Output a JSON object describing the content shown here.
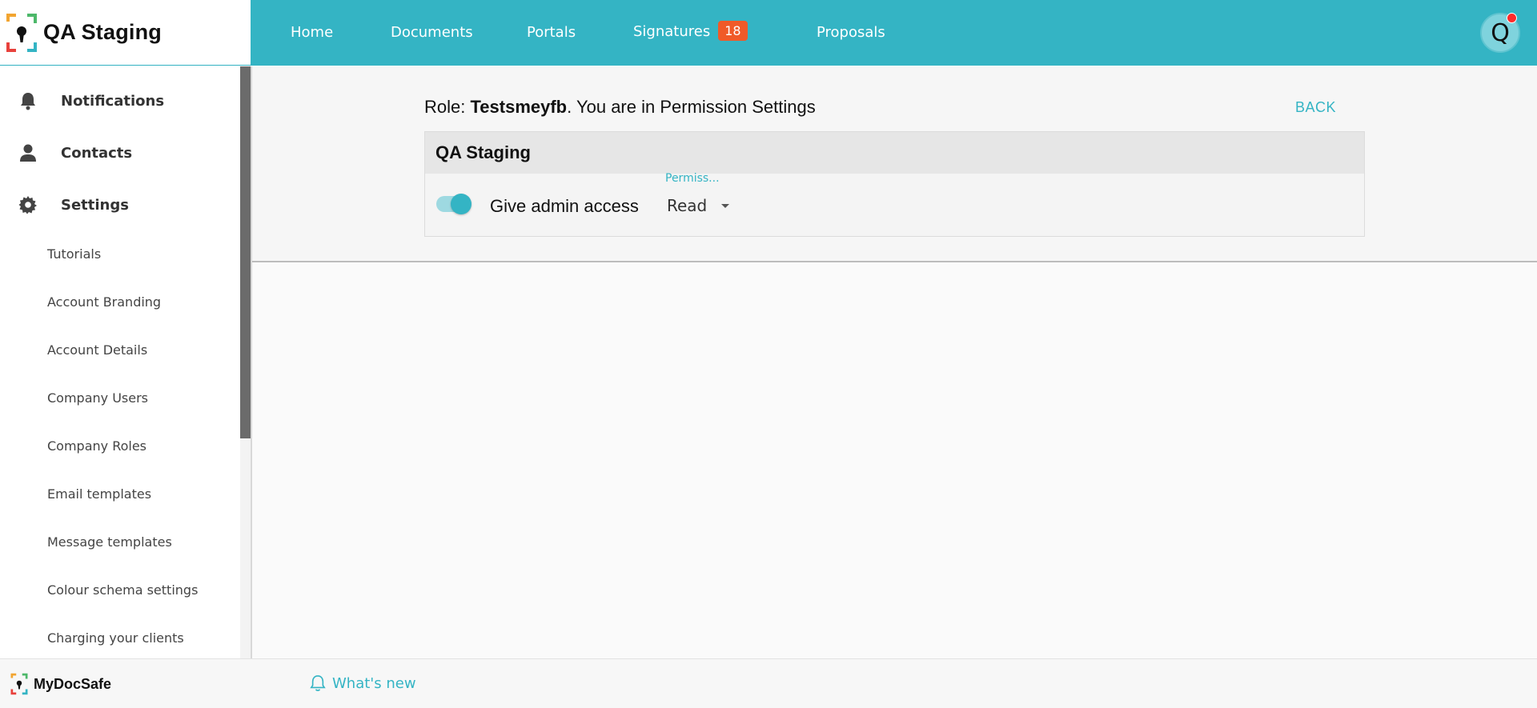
{
  "app": {
    "title": "QA Staging",
    "accent_color": "#34b4c4",
    "badge_color": "#f05a28"
  },
  "nav": {
    "items": [
      {
        "label": "Home"
      },
      {
        "label": "Documents"
      },
      {
        "label": "Portals"
      },
      {
        "label": "Signatures",
        "badge": "18"
      },
      {
        "label": "Proposals"
      }
    ],
    "avatar_letter": "Q"
  },
  "sidebar": {
    "main": [
      {
        "label": "Notifications",
        "icon": "bell-icon"
      },
      {
        "label": "Contacts",
        "icon": "person-icon"
      },
      {
        "label": "Settings",
        "icon": "gear-icon"
      }
    ],
    "sub": [
      {
        "label": "Tutorials"
      },
      {
        "label": "Account Branding"
      },
      {
        "label": "Account Details"
      },
      {
        "label": "Company Users"
      },
      {
        "label": "Company Roles"
      },
      {
        "label": "Email templates"
      },
      {
        "label": "Message templates"
      },
      {
        "label": "Colour schema settings"
      },
      {
        "label": "Charging your clients"
      }
    ]
  },
  "main": {
    "role_prefix": "Role: ",
    "role_name": "Testsmeyfb",
    "role_suffix": ". You are in Permission Settings",
    "back_label": "BACK",
    "card": {
      "title": "QA Staging",
      "toggle_on": true,
      "permission_label": "Give admin access",
      "select_caption": "Permiss...",
      "select_value": "Read"
    }
  },
  "footer": {
    "brand": "MyDocSafe",
    "whats_new": "What's new"
  }
}
